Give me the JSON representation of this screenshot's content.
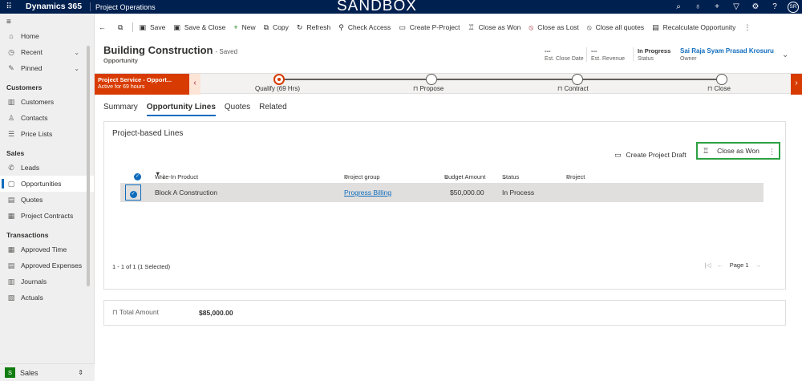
{
  "topbar": {
    "brand": "Dynamics 365",
    "app": "Project Operations",
    "environment": "SANDBOX",
    "avatar": "SR"
  },
  "sidebar": {
    "items_top": [
      {
        "label": "Home",
        "icon": "home-icon"
      },
      {
        "label": "Recent",
        "icon": "clock-icon"
      },
      {
        "label": "Pinned",
        "icon": "pin-icon"
      }
    ],
    "sections": [
      {
        "title": "Customers",
        "items": [
          "Customers",
          "Contacts",
          "Price Lists"
        ]
      },
      {
        "title": "Sales",
        "items": [
          "Leads",
          "Opportunities",
          "Quotes",
          "Project Contracts"
        ]
      },
      {
        "title": "Transactions",
        "items": [
          "Approved Time",
          "Approved Expenses",
          "Journals",
          "Actuals"
        ]
      }
    ],
    "active": "Opportunities",
    "area": {
      "badge": "S",
      "label": "Sales"
    }
  },
  "commandbar": {
    "items": [
      "Save",
      "Save & Close",
      "New",
      "Copy",
      "Refresh",
      "Check Access",
      "Create P-Project",
      "Close as Won",
      "Close as Lost",
      "Close all quotes",
      "Recalculate Opportunity"
    ]
  },
  "header": {
    "title": "Building Construction",
    "saved": "- Saved",
    "entity": "Opportunity",
    "est_close_date": {
      "value": "---",
      "label": "Est. Close Date"
    },
    "est_revenue": {
      "value": "---",
      "label": "Est. Revenue"
    },
    "status": {
      "value": "In Progress",
      "label": "Status"
    },
    "owner": {
      "value": "Sai Raja Syam Prasad Krosuru",
      "label": "Owner"
    }
  },
  "bpf": {
    "flag_title": "Project Service - Opport...",
    "flag_sub": "Active for 69 hours",
    "stages": [
      "Qualify  (69 Hrs)",
      "Propose",
      "Contract",
      "Close"
    ]
  },
  "tabs": [
    "Summary",
    "Opportunity Lines",
    "Quotes",
    "Related"
  ],
  "active_tab": "Opportunity Lines",
  "subgrid": {
    "title": "Project-based Lines",
    "create_draft": "Create Project Draft",
    "close_won": "Close as Won",
    "columns": [
      "Write-In Product",
      "Project group",
      "Budget Amount",
      "Status",
      "Project"
    ],
    "rows": [
      {
        "product": "Block A Construction",
        "group": "Progress Billing",
        "budget": "$50,000.00",
        "status": "In Process",
        "project": ""
      }
    ],
    "footer": "1 - 1 of 1 (1 Selected)",
    "page": "Page 1"
  },
  "totals": {
    "label": "Total Amount",
    "value": "$85,000.00"
  },
  "colors": {
    "topbar": "#002050",
    "accent": "#0f6cbd",
    "bpf_flag": "#d83b01",
    "highlight_border": "#2ea043"
  }
}
